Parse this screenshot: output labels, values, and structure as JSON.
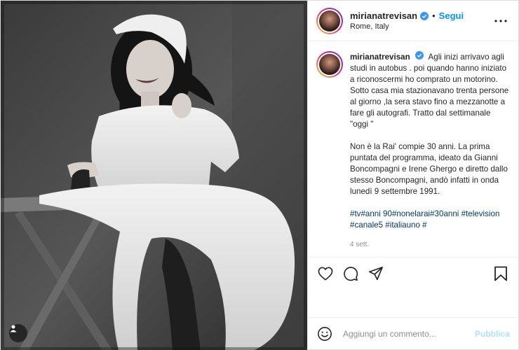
{
  "post": {
    "username": "mirianatrevisan",
    "follow_label": "Segui",
    "dot": "•",
    "location": "Rome, Italy",
    "caption_p1": "Agli inizi arrivavo agli studi in autobus . poi quando hanno iniziato a riconoscermi ho comprato un motorino. Sotto casa mia stazionavano trenta persone al giorno ,la sera stavo fino a mezzanotte a fare gli autografi. Tratto dal settimanale \"oggi \"",
    "caption_p2": "Non è la Rai' compie 30 anni. La prima puntata del programma, ideato da Gianni Boncompagni e Irene Ghergo e diretto dallo stesso Boncompagni, andò infatti in onda lunedì 9 settembre 1991.",
    "hashtags": [
      "#tv",
      "#anni 90",
      "#nonelarai",
      "#30anni",
      "#television",
      "#canale5",
      "#italiauno",
      "#"
    ],
    "age": "4 sett."
  },
  "comment": {
    "placeholder": "Aggiungi un commento...",
    "publish_label": "Pubblica"
  },
  "icons": {
    "more": "more-options-icon",
    "like": "heart-icon",
    "comment": "comment-icon",
    "share": "paper-plane-icon",
    "save": "bookmark-icon",
    "emoji": "emoji-icon",
    "tagged": "user-tag-icon",
    "verified": "verified-badge-icon"
  },
  "colors": {
    "accent": "#0095f6",
    "hashtag": "#00376b",
    "muted": "#8e8e8e",
    "publish_disabled": "#b2dffc"
  }
}
